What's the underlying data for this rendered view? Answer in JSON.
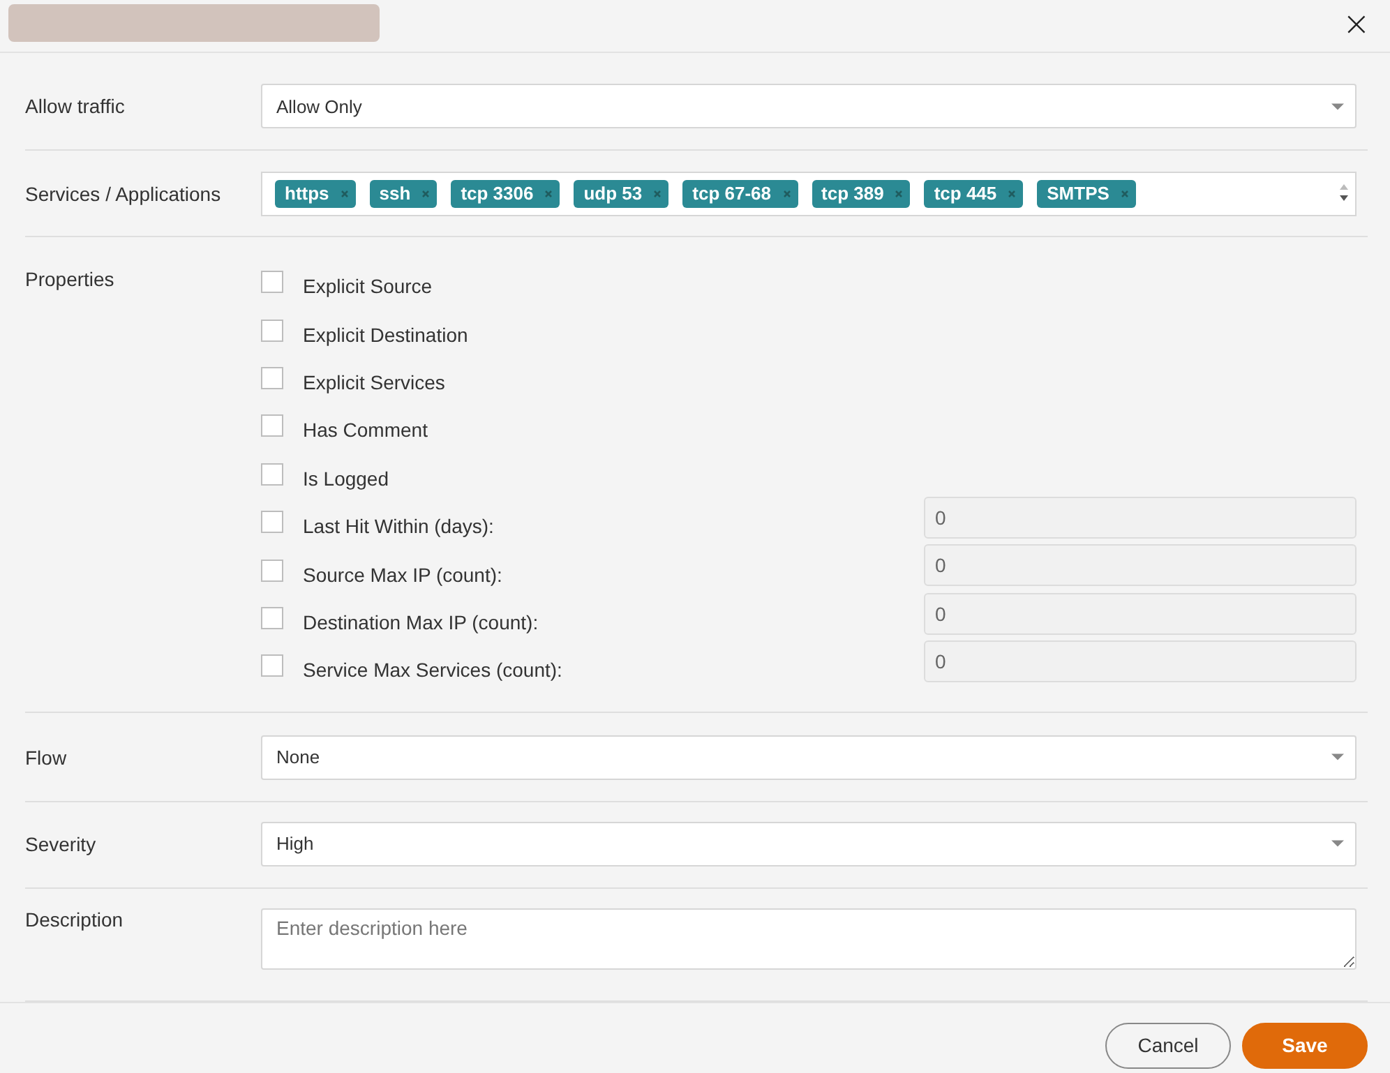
{
  "dialog": {
    "close_label": "×"
  },
  "allow_traffic": {
    "label": "Allow traffic",
    "value": "Allow Only"
  },
  "services": {
    "label": "Services / Applications",
    "tags": [
      "https",
      "ssh",
      "tcp 3306",
      "udp 53",
      "tcp 67-68",
      "tcp 389",
      "tcp 445",
      "SMTPS"
    ]
  },
  "properties": {
    "label": "Properties",
    "items": [
      {
        "kind": "checkbox",
        "label": "Explicit Source",
        "checked": false
      },
      {
        "kind": "checkbox",
        "label": "Explicit Destination",
        "checked": false
      },
      {
        "kind": "checkbox",
        "label": "Explicit Services",
        "checked": false
      },
      {
        "kind": "checkbox",
        "label": "Has Comment",
        "checked": false
      },
      {
        "kind": "checkbox",
        "label": "Is Logged",
        "checked": false
      },
      {
        "kind": "number",
        "label": "Last Hit Within (days):",
        "checked": false,
        "value": "0",
        "disabled": true
      },
      {
        "kind": "number",
        "label": "Source Max IP (count):",
        "checked": false,
        "value": "0",
        "disabled": true
      },
      {
        "kind": "number",
        "label": "Destination Max IP (count):",
        "checked": false,
        "value": "0",
        "disabled": true
      },
      {
        "kind": "number",
        "label": "Service Max Services (count):",
        "checked": false,
        "value": "0",
        "disabled": true
      }
    ]
  },
  "flow": {
    "label": "Flow",
    "value": "None"
  },
  "severity": {
    "label": "Severity",
    "value": "High"
  },
  "description": {
    "label": "Description",
    "placeholder": "Enter description here"
  },
  "buttons": [
    {
      "kind": "secondary",
      "label": "Cancel"
    },
    {
      "kind": "primary",
      "label": "Save"
    }
  ]
}
